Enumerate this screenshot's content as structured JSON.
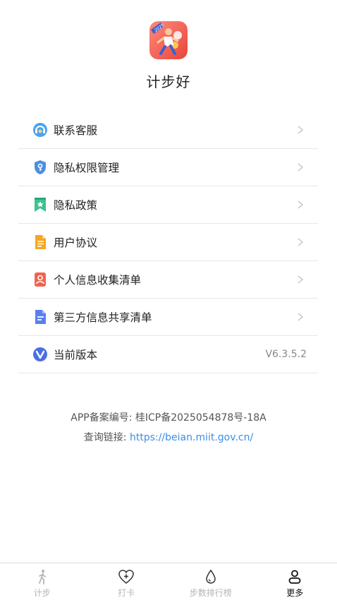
{
  "app": {
    "name": "计步好",
    "logo_badge": "2025"
  },
  "menu": {
    "items": [
      {
        "label": "联系客服",
        "icon": "customer-service-icon"
      },
      {
        "label": "隐私权限管理",
        "icon": "privacy-shield-icon"
      },
      {
        "label": "隐私政策",
        "icon": "bookmark-star-icon"
      },
      {
        "label": "用户协议",
        "icon": "document-icon"
      },
      {
        "label": "个人信息收集清单",
        "icon": "person-card-icon"
      },
      {
        "label": "第三方信息共享清单",
        "icon": "share-doc-icon"
      },
      {
        "label": "当前版本",
        "icon": "version-v-icon",
        "value": "V6.3.5.2"
      }
    ]
  },
  "filing": {
    "record_label": "APP备案编号: 桂ICP备2025054878号-18A",
    "query_prefix": "查询链接: ",
    "query_url": "https://beian.miit.gov.cn/"
  },
  "tabbar": {
    "tabs": [
      {
        "label": "计步",
        "icon": "walking-person-icon",
        "active": false
      },
      {
        "label": "打卡",
        "icon": "heart-plus-icon",
        "active": false
      },
      {
        "label": "步数排行榜",
        "icon": "water-drop-icon",
        "active": false
      },
      {
        "label": "更多",
        "icon": "person-icon",
        "active": true
      }
    ]
  },
  "colors": {
    "link": "#3a8ee6",
    "accent_blue": "#4a90e2",
    "inactive_tab": "#b5b5b5",
    "active_tab": "#111111"
  }
}
